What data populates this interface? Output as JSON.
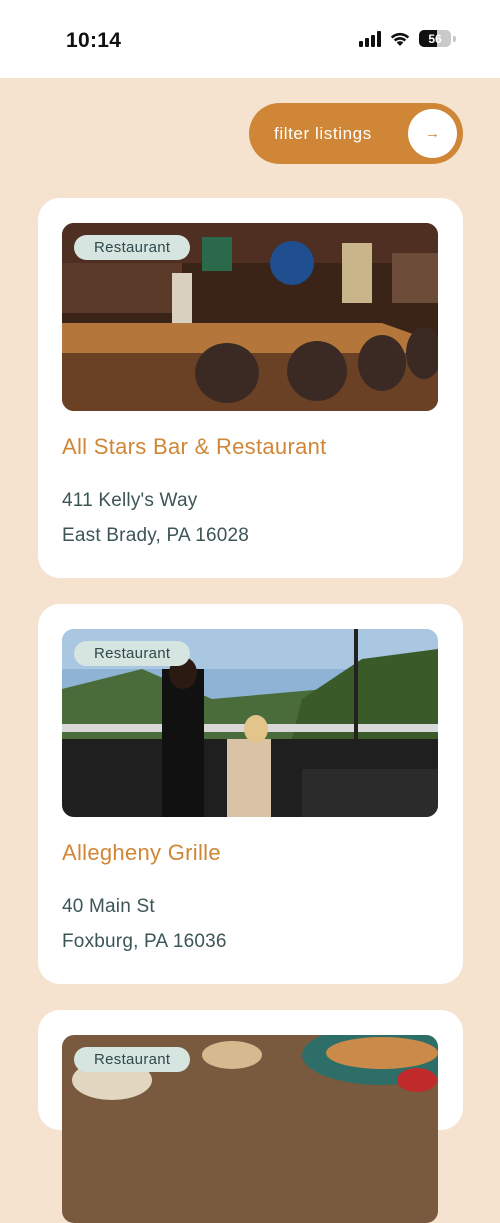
{
  "status_bar": {
    "time": "10:14",
    "battery": "56"
  },
  "filter": {
    "label": "filter listings",
    "arrow_icon": "→"
  },
  "listings": [
    {
      "category": "Restaurant",
      "name": "All Stars Bar & Restaurant",
      "street": "411 Kelly's Way",
      "city": "East Brady, PA 16028",
      "photo": "bar-interior-photo"
    },
    {
      "category": "Restaurant",
      "name": "Allegheny Grille",
      "street": "40 Main St",
      "city": "Foxburg, PA 16036",
      "photo": "outdoor-deck-dining-photo"
    },
    {
      "category": "Restaurant",
      "photo": "food-plates-photo"
    }
  ],
  "colors": {
    "accent": "#cf8636",
    "background": "#f5e3d0",
    "badge": "#d7e5e1",
    "text": "#3c5555"
  }
}
